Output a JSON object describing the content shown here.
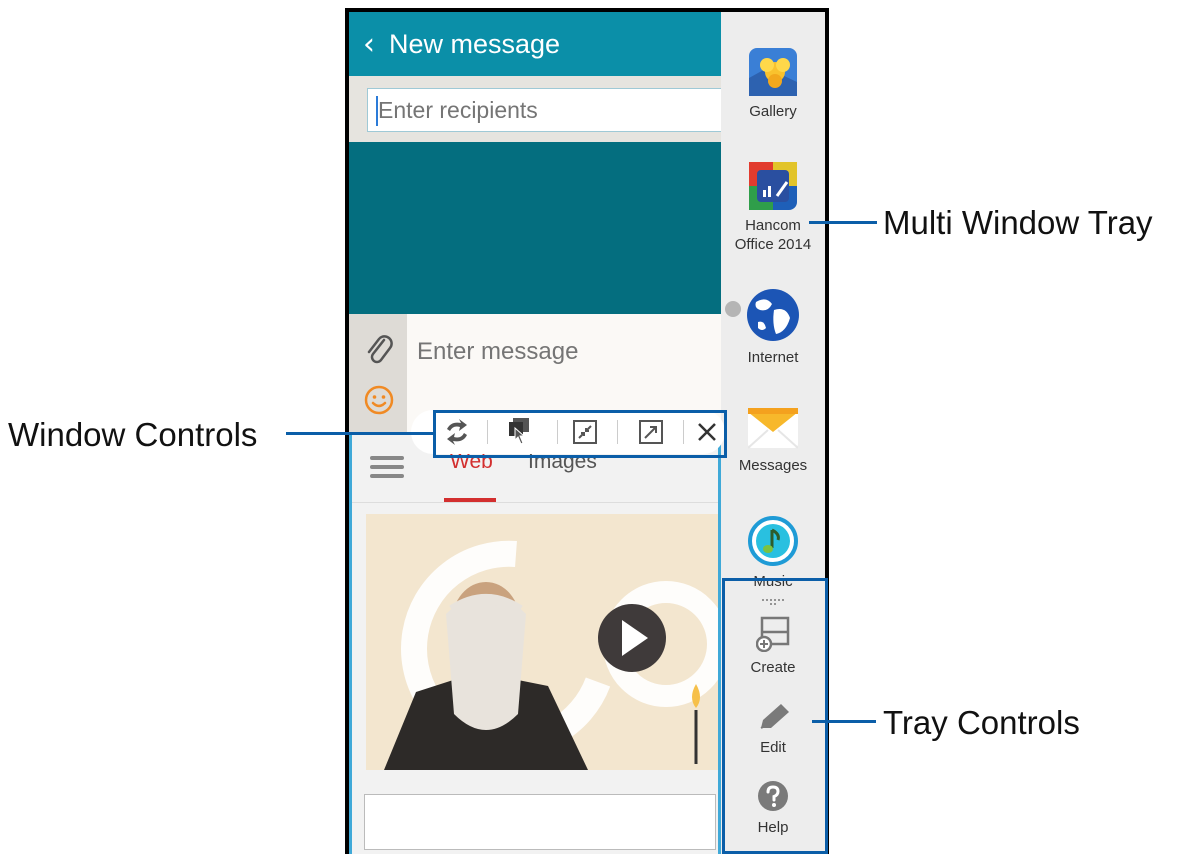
{
  "header": {
    "title": "New message"
  },
  "compose": {
    "recipients_placeholder": "Enter recipients",
    "message_placeholder": "Enter message"
  },
  "browser": {
    "tabs": [
      "Web",
      "Images"
    ]
  },
  "window_controls": {
    "icons": [
      "switch-windows-icon",
      "drag-content-icon",
      "minimize-icon",
      "maximize-icon",
      "close-icon"
    ]
  },
  "tray": {
    "apps": [
      {
        "label": "Gallery",
        "icon": "gallery-icon"
      },
      {
        "label": "Hancom\nOffice 2014",
        "icon": "hancom-office-icon"
      },
      {
        "label": "Internet",
        "icon": "internet-globe-icon"
      },
      {
        "label": "Messages",
        "icon": "messages-envelope-icon"
      },
      {
        "label": "Music",
        "icon": "music-note-icon"
      }
    ],
    "controls": [
      {
        "label": "Create",
        "icon": "create-window-icon"
      },
      {
        "label": "Edit",
        "icon": "edit-pencil-icon"
      },
      {
        "label": "Help",
        "icon": "help-question-icon"
      }
    ]
  },
  "callouts": {
    "multi_window_tray": "Multi Window Tray",
    "window_controls": "Window Controls",
    "tray_controls": "Tray Controls"
  },
  "colors": {
    "header": "#0b8fa8",
    "compose_teal": "#046e7f",
    "callout": "#0b5ea8",
    "tab_active": "#d32f2f"
  }
}
